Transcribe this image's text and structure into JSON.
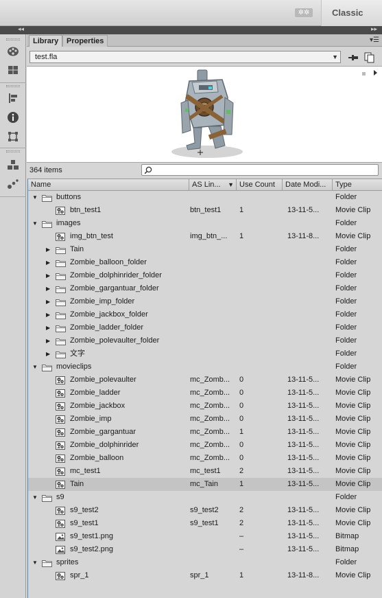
{
  "topbar": {
    "sync_icon": "sync-icon",
    "workspace": "Classic"
  },
  "panel": {
    "tabs": [
      {
        "label": "Library"
      },
      {
        "label": "Properties"
      }
    ],
    "document": "test.fla",
    "item_count": "364 items",
    "search_placeholder": ""
  },
  "columns": {
    "name": "Name",
    "linkage": "AS Lin...",
    "use_count": "Use Count",
    "date": "Date Modi...",
    "type": "Type"
  },
  "rows": [
    {
      "level": 0,
      "expanded": true,
      "icon": "folder",
      "name": "buttons",
      "linkage": "",
      "use": "",
      "date": "",
      "type": "Folder"
    },
    {
      "level": 1,
      "icon": "movie",
      "name": "btn_test1",
      "linkage": "btn_test1",
      "use": "1",
      "date": "13-11-5...",
      "type": "Movie Clip"
    },
    {
      "level": 0,
      "expanded": true,
      "icon": "folder",
      "name": "images",
      "linkage": "",
      "use": "",
      "date": "",
      "type": "Folder"
    },
    {
      "level": 1,
      "icon": "movie",
      "name": "img_btn_test",
      "linkage": "img_btn_...",
      "use": "1",
      "date": "13-11-8...",
      "type": "Movie Clip"
    },
    {
      "level": 1,
      "expanded": false,
      "icon": "folder",
      "name": "Tain",
      "linkage": "",
      "use": "",
      "date": "",
      "type": "Folder"
    },
    {
      "level": 1,
      "expanded": false,
      "icon": "folder",
      "name": "Zombie_balloon_folder",
      "linkage": "",
      "use": "",
      "date": "",
      "type": "Folder"
    },
    {
      "level": 1,
      "expanded": false,
      "icon": "folder",
      "name": "Zombie_dolphinrider_folder",
      "linkage": "",
      "use": "",
      "date": "",
      "type": "Folder"
    },
    {
      "level": 1,
      "expanded": false,
      "icon": "folder",
      "name": "Zombie_gargantuar_folder",
      "linkage": "",
      "use": "",
      "date": "",
      "type": "Folder"
    },
    {
      "level": 1,
      "expanded": false,
      "icon": "folder",
      "name": "Zombie_imp_folder",
      "linkage": "",
      "use": "",
      "date": "",
      "type": "Folder"
    },
    {
      "level": 1,
      "expanded": false,
      "icon": "folder",
      "name": "Zombie_jackbox_folder",
      "linkage": "",
      "use": "",
      "date": "",
      "type": "Folder"
    },
    {
      "level": 1,
      "expanded": false,
      "icon": "folder",
      "name": "Zombie_ladder_folder",
      "linkage": "",
      "use": "",
      "date": "",
      "type": "Folder"
    },
    {
      "level": 1,
      "expanded": false,
      "icon": "folder",
      "name": "Zombie_polevaulter_folder",
      "linkage": "",
      "use": "",
      "date": "",
      "type": "Folder"
    },
    {
      "level": 1,
      "expanded": false,
      "icon": "folder",
      "name": "文字",
      "linkage": "",
      "use": "",
      "date": "",
      "type": "Folder"
    },
    {
      "level": 0,
      "expanded": true,
      "icon": "folder",
      "name": "movieclips",
      "linkage": "",
      "use": "",
      "date": "",
      "type": "Folder"
    },
    {
      "level": 1,
      "icon": "movie",
      "name": "Zombie_polevaulter",
      "linkage": "mc_Zomb...",
      "use": "0",
      "date": "13-11-5...",
      "type": "Movie Clip"
    },
    {
      "level": 1,
      "icon": "movie",
      "name": "Zombie_ladder",
      "linkage": "mc_Zomb...",
      "use": "0",
      "date": "13-11-5...",
      "type": "Movie Clip"
    },
    {
      "level": 1,
      "icon": "movie",
      "name": "Zombie_jackbox",
      "linkage": "mc_Zomb...",
      "use": "0",
      "date": "13-11-5...",
      "type": "Movie Clip"
    },
    {
      "level": 1,
      "icon": "movie",
      "name": "Zombie_imp",
      "linkage": "mc_Zomb...",
      "use": "0",
      "date": "13-11-5...",
      "type": "Movie Clip"
    },
    {
      "level": 1,
      "icon": "movie",
      "name": "Zombie_gargantuar",
      "linkage": "mc_Zomb...",
      "use": "1",
      "date": "13-11-5...",
      "type": "Movie Clip"
    },
    {
      "level": 1,
      "icon": "movie",
      "name": "Zombie_dolphinrider",
      "linkage": "mc_Zomb...",
      "use": "0",
      "date": "13-11-5...",
      "type": "Movie Clip"
    },
    {
      "level": 1,
      "icon": "movie",
      "name": "Zombie_balloon",
      "linkage": "mc_Zomb...",
      "use": "0",
      "date": "13-11-5...",
      "type": "Movie Clip"
    },
    {
      "level": 1,
      "icon": "movie",
      "name": "mc_test1",
      "linkage": "mc_test1",
      "use": "2",
      "date": "13-11-5...",
      "type": "Movie Clip"
    },
    {
      "level": 1,
      "icon": "movie",
      "name": "Tain",
      "linkage": "mc_Tain",
      "use": "1",
      "date": "13-11-5...",
      "type": "Movie Clip",
      "selected": true
    },
    {
      "level": 0,
      "expanded": true,
      "icon": "folder",
      "name": "s9",
      "linkage": "",
      "use": "",
      "date": "",
      "type": "Folder"
    },
    {
      "level": 1,
      "icon": "movie",
      "name": "s9_test2",
      "linkage": "s9_test2",
      "use": "2",
      "date": "13-11-5...",
      "type": "Movie Clip"
    },
    {
      "level": 1,
      "icon": "movie",
      "name": "s9_test1",
      "linkage": "s9_test1",
      "use": "2",
      "date": "13-11-5...",
      "type": "Movie Clip"
    },
    {
      "level": 1,
      "icon": "bitmap",
      "name": "s9_test1.png",
      "linkage": "",
      "use": "–",
      "date": "13-11-5...",
      "type": "Bitmap"
    },
    {
      "level": 1,
      "icon": "bitmap",
      "name": "s9_test2.png",
      "linkage": "",
      "use": "–",
      "date": "13-11-5...",
      "type": "Bitmap"
    },
    {
      "level": 0,
      "expanded": true,
      "icon": "folder",
      "name": "sprites",
      "linkage": "",
      "use": "",
      "date": "",
      "type": "Folder"
    },
    {
      "level": 1,
      "icon": "movie",
      "name": "spr_1",
      "linkage": "spr_1",
      "use": "1",
      "date": "13-11-8...",
      "type": "Movie Clip"
    }
  ]
}
